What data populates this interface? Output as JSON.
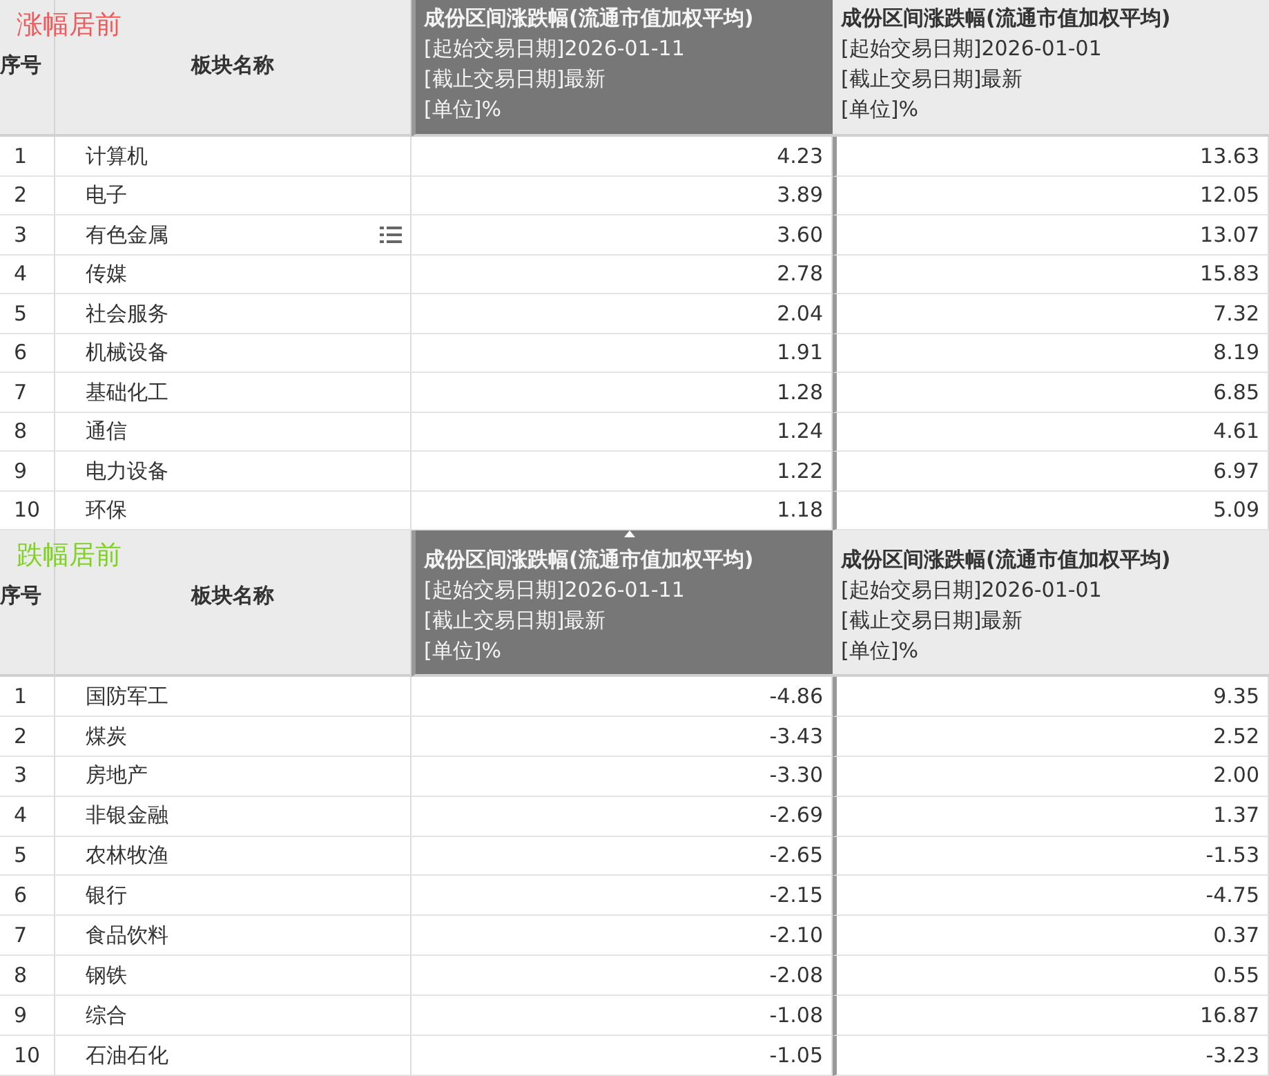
{
  "tables": [
    {
      "title": "涨幅居前",
      "color": "#f05a5a",
      "columns": [
        {
          "label": "序号",
          "selected": false
        },
        {
          "label": "板块名称",
          "selected": false
        },
        {
          "label": "成份区间涨跌幅(流通市值加权平均)",
          "lines": [
            "[起始交易日期]2026-01-11",
            "[截止交易日期]最新",
            "[单位]%"
          ],
          "selected": true,
          "sort_icon": false
        },
        {
          "label": "成份区间涨跌幅(流通市值加权平均)",
          "lines": [
            "[起始交易日期]2026-01-01",
            "[截止交易日期]最新",
            "[单位]%"
          ],
          "selected": false,
          "sort_icon": false
        }
      ],
      "rows": [
        {
          "cells": [
            "1",
            "计算机",
            "4.23",
            "13.63"
          ],
          "menu_icon": false
        },
        {
          "cells": [
            "2",
            "电子",
            "3.89",
            "12.05"
          ],
          "menu_icon": false
        },
        {
          "cells": [
            "3",
            "有色金属",
            "3.60",
            "13.07"
          ],
          "menu_icon": true
        },
        {
          "cells": [
            "4",
            "传媒",
            "2.78",
            "15.83"
          ],
          "menu_icon": false
        },
        {
          "cells": [
            "5",
            "社会服务",
            "2.04",
            "7.32"
          ],
          "menu_icon": false
        },
        {
          "cells": [
            "6",
            "机械设备",
            "1.91",
            "8.19"
          ],
          "menu_icon": false
        },
        {
          "cells": [
            "7",
            "基础化工",
            "1.28",
            "6.85"
          ],
          "menu_icon": false
        },
        {
          "cells": [
            "8",
            "通信",
            "1.24",
            "4.61"
          ],
          "menu_icon": false
        },
        {
          "cells": [
            "9",
            "电力设备",
            "1.22",
            "6.97"
          ],
          "menu_icon": false
        },
        {
          "cells": [
            "10",
            "环保",
            "1.18",
            "5.09"
          ],
          "menu_icon": false
        }
      ]
    },
    {
      "title": "跌幅居前",
      "color": "#7ed321",
      "columns": [
        {
          "label": "序号",
          "selected": false
        },
        {
          "label": "板块名称",
          "selected": false
        },
        {
          "label": "成份区间涨跌幅(流通市值加权平均)",
          "lines": [
            "[起始交易日期]2026-01-11",
            "[截止交易日期]最新",
            "[单位]%"
          ],
          "selected": true,
          "sort_icon": true
        },
        {
          "label": "成份区间涨跌幅(流通市值加权平均)",
          "lines": [
            "[起始交易日期]2026-01-01",
            "[截止交易日期]最新",
            "[单位]%"
          ],
          "selected": false,
          "sort_icon": false
        }
      ],
      "rows": [
        {
          "cells": [
            "1",
            "国防军工",
            "-4.86",
            "9.35"
          ],
          "menu_icon": false
        },
        {
          "cells": [
            "2",
            "煤炭",
            "-3.43",
            "2.52"
          ],
          "menu_icon": false
        },
        {
          "cells": [
            "3",
            "房地产",
            "-3.30",
            "2.00"
          ],
          "menu_icon": false
        },
        {
          "cells": [
            "4",
            "非银金融",
            "-2.69",
            "1.37"
          ],
          "menu_icon": false
        },
        {
          "cells": [
            "5",
            "农林牧渔",
            "-2.65",
            "-1.53"
          ],
          "menu_icon": false
        },
        {
          "cells": [
            "6",
            "银行",
            "-2.15",
            "-4.75"
          ],
          "menu_icon": false
        },
        {
          "cells": [
            "7",
            "食品饮料",
            "-2.10",
            "0.37"
          ],
          "menu_icon": false
        },
        {
          "cells": [
            "8",
            "钢铁",
            "-2.08",
            "0.55"
          ],
          "menu_icon": false
        },
        {
          "cells": [
            "9",
            "综合",
            "-1.08",
            "16.87"
          ],
          "menu_icon": false
        },
        {
          "cells": [
            "10",
            "石油石化",
            "-1.05",
            "-3.23"
          ],
          "menu_icon": false
        }
      ]
    }
  ]
}
